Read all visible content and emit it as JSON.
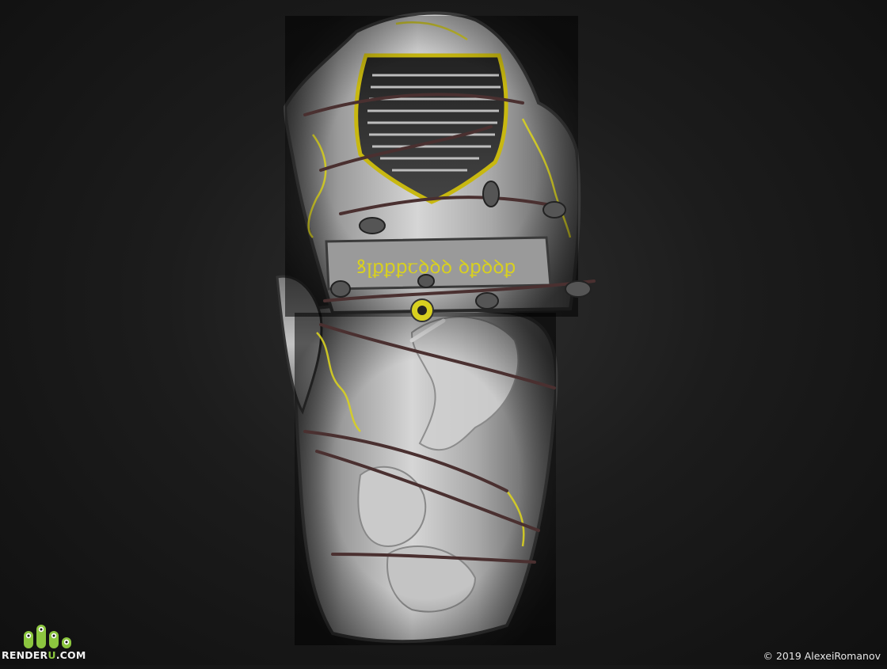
{
  "render": {
    "subject_icon": "engraved-armor-shield-render",
    "colors": {
      "background": "#1a1a1a",
      "metal": "#bdbdbd",
      "gold_engraving": "#d8d020",
      "straps": "#4a3030",
      "logo_green": "#8cc63f"
    }
  },
  "inscription": "ꝸꞁꝑꝑꝑꞇꝺꝺꝺ ꝺꝑꝺꝺꝑ",
  "watermark": {
    "logo_prefix": "RENDER",
    "logo_accent": "U",
    "logo_suffix": ".COM",
    "copyright": "© 2019 AlexeiRomanov"
  }
}
